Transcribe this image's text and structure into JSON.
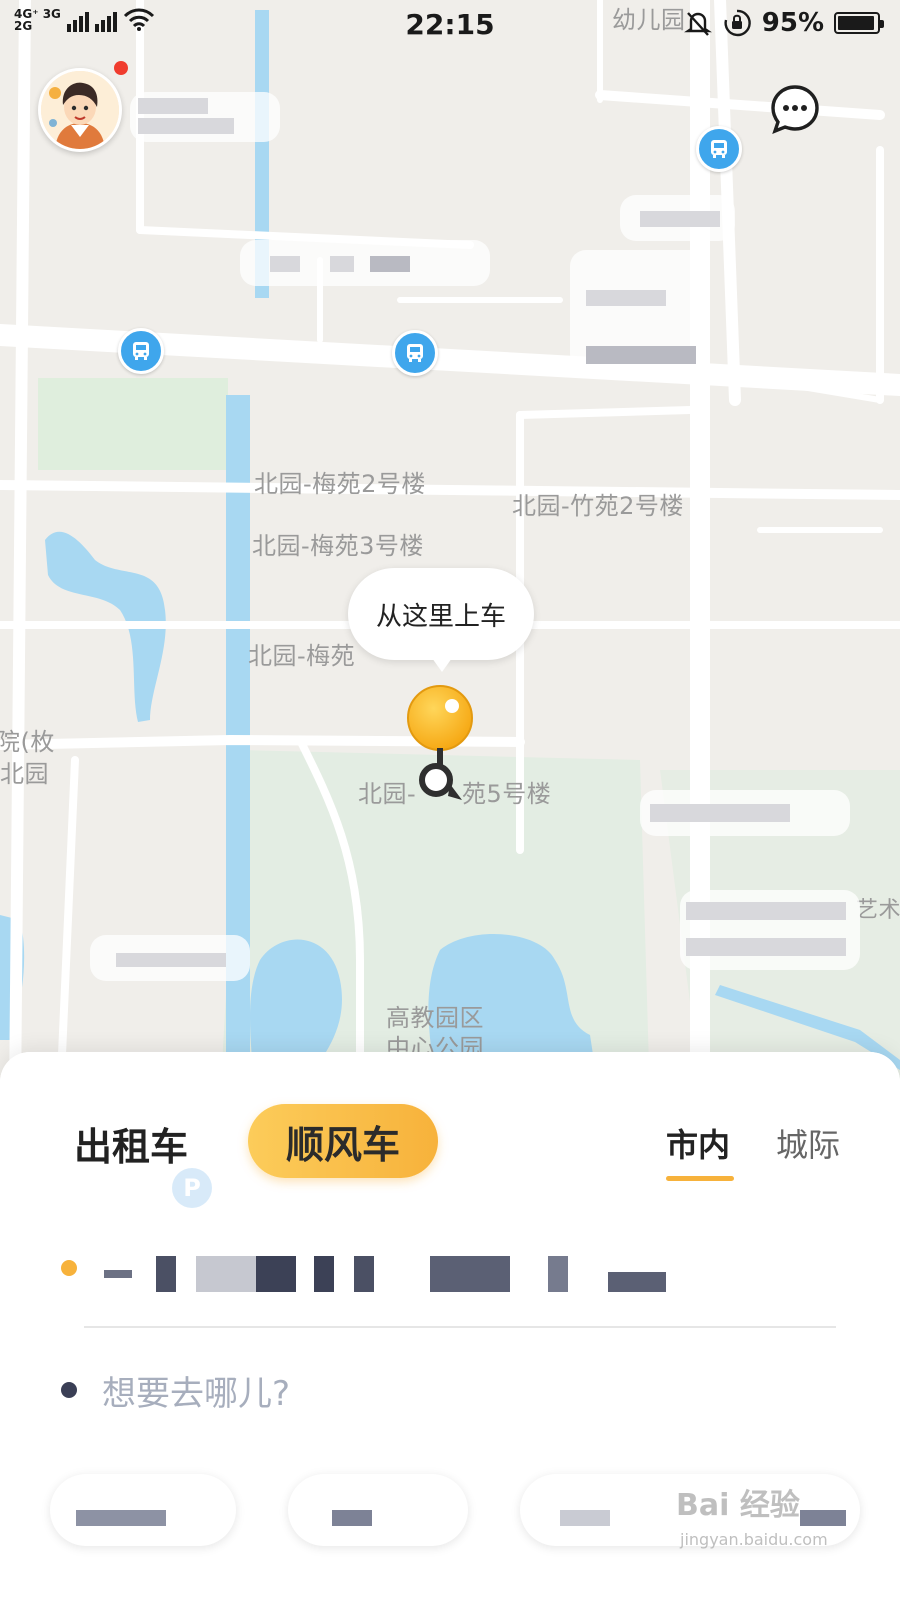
{
  "status_bar": {
    "network_top": "4G⁺ 3G",
    "network_bottom": "2G",
    "time": "22:15",
    "battery_percent": "95%",
    "battery_level": 0.95,
    "icons": [
      "signal-icon",
      "wifi-icon",
      "mute-icon",
      "rotation-lock-icon",
      "battery-icon"
    ]
  },
  "map": {
    "labels": {
      "kindergarten": "幼儿园",
      "meiyuan2": "北园-梅苑2号楼",
      "meiyuan3": "北园-梅苑3号楼",
      "meiyuan_partial": "北园-梅苑",
      "zhuyuan2": "北园-竹苑2号楼",
      "building5_prefix": "北园-",
      "building5_suffix": "苑5号楼",
      "left_partial_1": "院(枚",
      "left_partial_2": "北园",
      "park_line1": "高教园区",
      "park_line2": "中心公园",
      "right_partial": "艺术"
    },
    "pickup_bubble": "从这里上车"
  },
  "top_controls": {
    "avatar_icon": "user-avatar",
    "chat_icon": "chat-bubble-icon"
  },
  "panel": {
    "tab_taxi": "出租车",
    "tab_carpool": "顺风车",
    "subtab_city": "市内",
    "subtab_intercity": "城际",
    "parking_icon_label": "P",
    "destination_placeholder": "想要去哪儿?"
  },
  "watermark": {
    "brand": "Bai 经验",
    "url": "jingyan.baidu.com"
  },
  "colors": {
    "accent_yellow": "#f7b23b",
    "map_water": "#a8d8f2",
    "map_green": "#e2ede3",
    "bus_blue": "#3fa6ec"
  }
}
